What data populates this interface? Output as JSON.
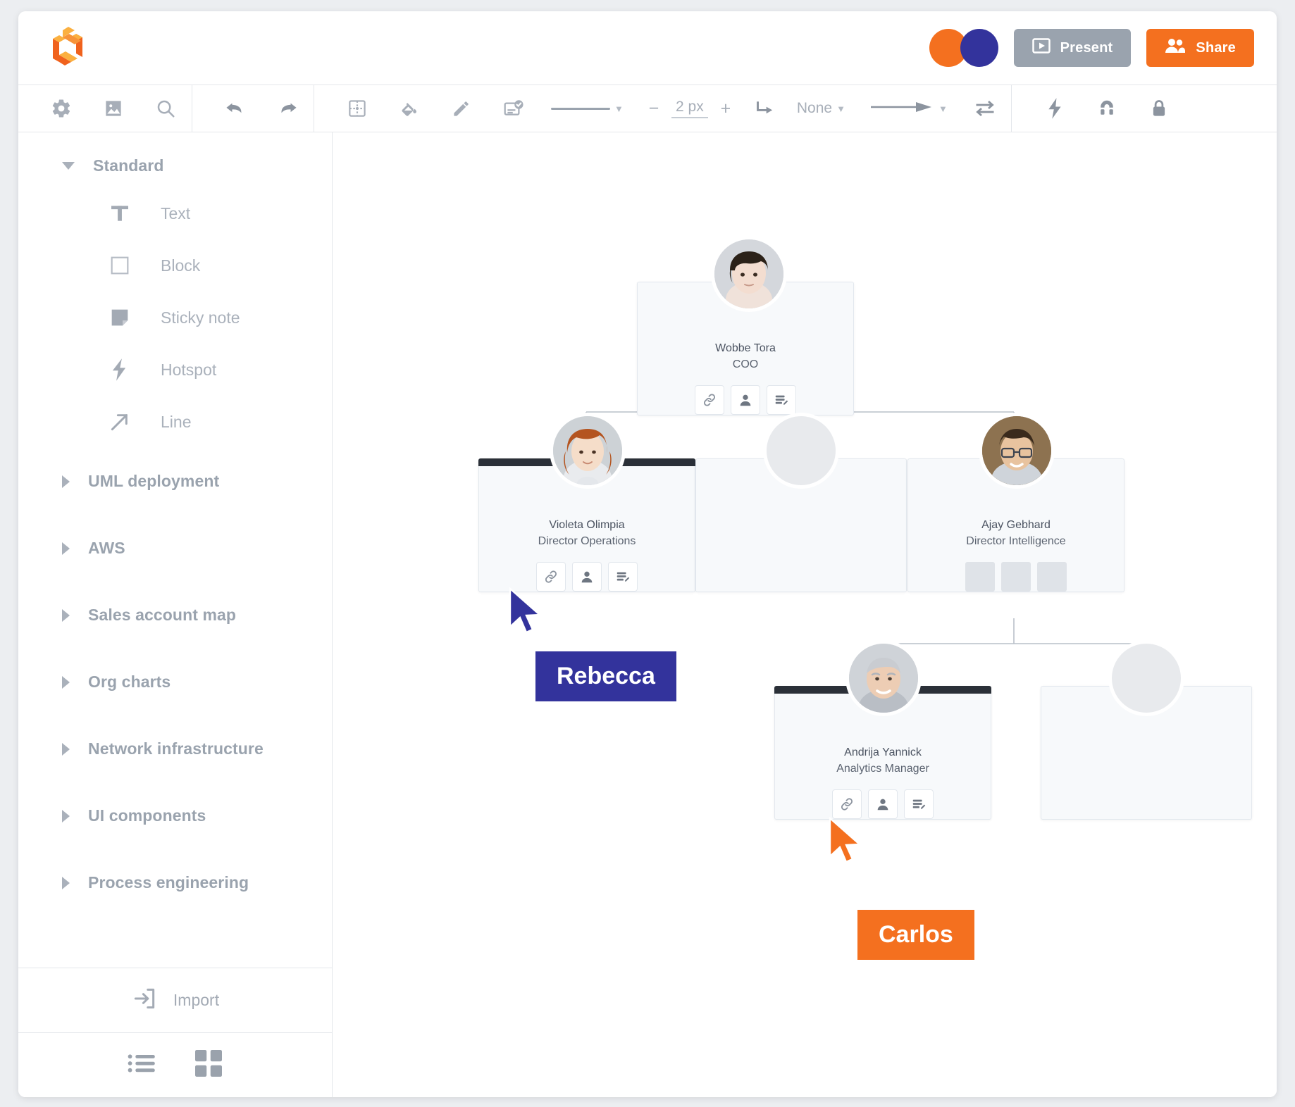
{
  "app": {
    "logo_icon": "lucid-logo-icon"
  },
  "header": {
    "collaborators": [
      {
        "name_icon": "collaborator-avatar-orange",
        "color": "#f4701f"
      },
      {
        "name_icon": "collaborator-avatar-blue",
        "color": "#33339c"
      }
    ],
    "present_label": "Present",
    "share_label": "Share",
    "present_icon": "play-screen-icon",
    "share_icon": "people-icon"
  },
  "toolbar": {
    "settings_icon": "gear-icon",
    "image_icon": "image-icon",
    "search_icon": "search-icon",
    "undo_icon": "undo-icon",
    "redo_icon": "redo-icon",
    "shape_icon": "frame-shape-icon",
    "fill_icon": "fill-bucket-icon",
    "line_color_icon": "pencil-icon",
    "text_style_icon": "text-style-icon",
    "line_style_icon": "line-style-icon",
    "line_style_caret": "chevron-down-icon",
    "stroke_minus": "−",
    "stroke_value": "2 px",
    "stroke_plus": "+",
    "elbow_icon": "elbow-line-icon",
    "line_jump_value": "None",
    "line_jump_caret": "chevron-down-icon",
    "arrow_end_icon": "arrow-end-icon",
    "arrow_end_caret": "chevron-down-icon",
    "swap_icon": "swap-arrows-icon",
    "hotspot_icon": "lightning-icon",
    "magnet_icon": "magnet-icon",
    "lock_icon": "lock-icon"
  },
  "sidebar": {
    "standard": {
      "title": "Standard",
      "expanded": true,
      "items": [
        {
          "label": "Text",
          "icon": "text-t-icon"
        },
        {
          "label": "Block",
          "icon": "square-outline-icon"
        },
        {
          "label": "Sticky note",
          "icon": "sticky-note-icon"
        },
        {
          "label": "Hotspot",
          "icon": "lightning-icon"
        },
        {
          "label": "Line",
          "icon": "diagonal-arrow-icon"
        }
      ]
    },
    "categories": [
      {
        "label": "UML deployment"
      },
      {
        "label": "AWS"
      },
      {
        "label": "Sales account map"
      },
      {
        "label": "Org charts"
      },
      {
        "label": "Network infrastructure"
      },
      {
        "label": "UI components"
      },
      {
        "label": "Process engineering"
      }
    ],
    "import_label": "Import",
    "import_icon": "import-arrow-icon",
    "list_view_icon": "list-view-icon",
    "grid_view_icon": "grid-view-icon"
  },
  "canvas": {
    "nodes": [
      {
        "id": "ceo",
        "name": "Wobbe Tora",
        "role": "COO",
        "has_avatar": true,
        "avatar_kind": "photo-woman-dark-hair",
        "actions": [
          "link-icon",
          "person-icon",
          "document-layers-icon"
        ],
        "header_bar": false
      },
      {
        "id": "ops",
        "name": "Violeta Olimpia",
        "role": "Director Operations",
        "has_avatar": true,
        "avatar_kind": "photo-woman-red-hair",
        "actions": [
          "link-icon",
          "person-icon",
          "document-layers-icon"
        ],
        "header_bar": true
      },
      {
        "id": "empty-middle",
        "name": "",
        "role": "",
        "has_avatar": true,
        "avatar_kind": "blank",
        "actions": [],
        "header_bar": false
      },
      {
        "id": "intel",
        "name": "Ajay Gebhard",
        "role": "Director Intelligence",
        "has_avatar": true,
        "avatar_kind": "photo-man-glasses",
        "actions": [
          "placeholder",
          "placeholder",
          "placeholder"
        ],
        "header_bar": false
      },
      {
        "id": "analytics",
        "name": "Andrija Yannick",
        "role": "Analytics Manager",
        "has_avatar": true,
        "avatar_kind": "photo-man-older",
        "actions": [
          "link-icon",
          "person-icon",
          "document-layers-icon"
        ],
        "header_bar": true
      },
      {
        "id": "empty-right",
        "name": "",
        "role": "",
        "has_avatar": true,
        "avatar_kind": "blank",
        "actions": [],
        "header_bar": false
      }
    ],
    "cursors": [
      {
        "label": "Rebecca",
        "color": "#33339c"
      },
      {
        "label": "Carlos",
        "color": "#f4701f"
      }
    ]
  }
}
